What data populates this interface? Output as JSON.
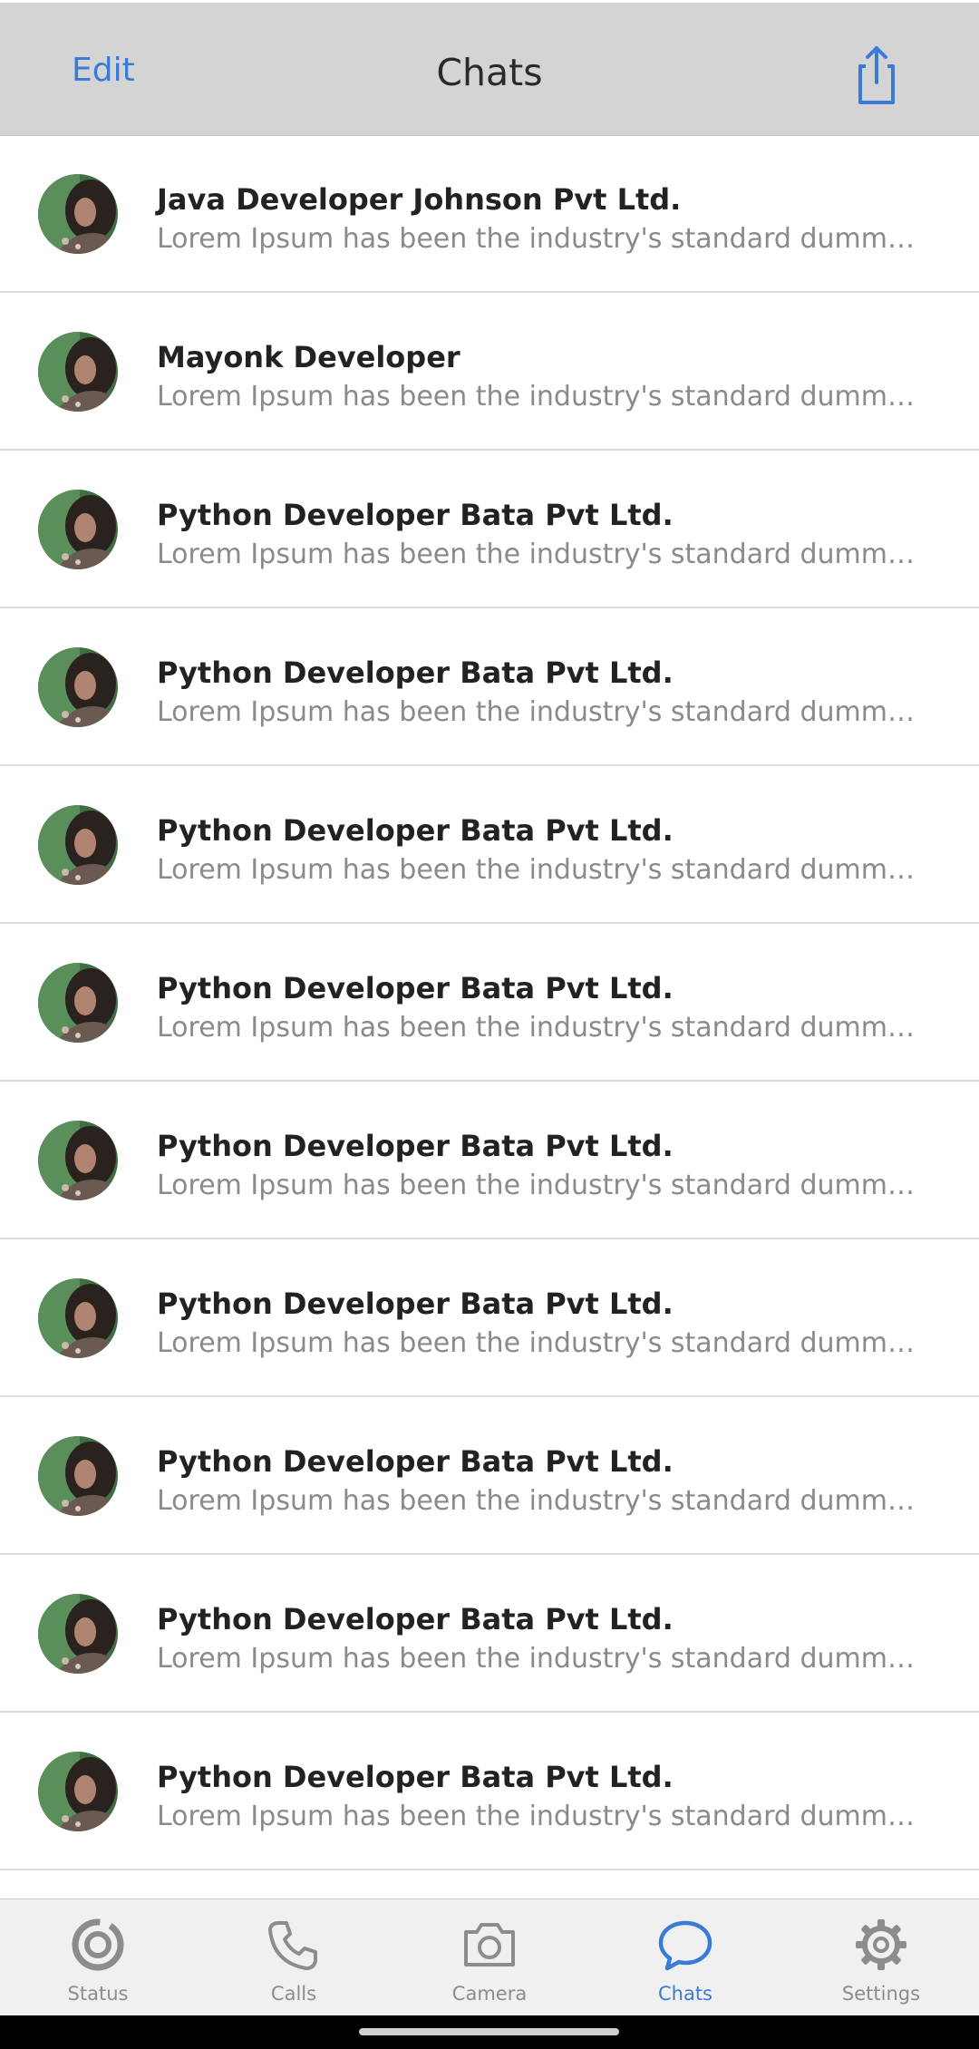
{
  "header": {
    "edit_label": "Edit",
    "title": "Chats",
    "share_icon": "share-icon"
  },
  "chats": [
    {
      "name": "Java Developer Johnson Pvt Ltd.",
      "preview": "Lorem Ipsum has been the industry's standard dummy text ev..."
    },
    {
      "name": "Mayonk Developer",
      "preview": "Lorem Ipsum has been the industry's standard dummy text ev..."
    },
    {
      "name": "Python Developer Bata Pvt Ltd.",
      "preview": "Lorem Ipsum has been the industry's standard dummy text ev..."
    },
    {
      "name": "Python Developer Bata Pvt Ltd.",
      "preview": "Lorem Ipsum has been the industry's standard dummy text ev..."
    },
    {
      "name": "Python Developer Bata Pvt Ltd.",
      "preview": "Lorem Ipsum has been the industry's standard dummy text ev..."
    },
    {
      "name": "Python Developer Bata Pvt Ltd.",
      "preview": "Lorem Ipsum has been the industry's standard dummy text ev..."
    },
    {
      "name": "Python Developer Bata Pvt Ltd.",
      "preview": "Lorem Ipsum has been the industry's standard dummy text ev..."
    },
    {
      "name": "Python Developer Bata Pvt Ltd.",
      "preview": "Lorem Ipsum has been the industry's standard dummy text ev..."
    },
    {
      "name": "Python Developer Bata Pvt Ltd.",
      "preview": "Lorem Ipsum has been the industry's standard dummy text ev..."
    },
    {
      "name": "Python Developer Bata Pvt Ltd.",
      "preview": "Lorem Ipsum has been the industry's standard dummy text ev..."
    },
    {
      "name": "Python Developer Bata Pvt Ltd.",
      "preview": "Lorem Ipsum has been the industry's standard dummy text ev..."
    }
  ],
  "tabbar": {
    "tabs": [
      {
        "label": "Status",
        "icon": "status-icon",
        "active": false
      },
      {
        "label": "Calls",
        "icon": "phone-icon",
        "active": false
      },
      {
        "label": "Camera",
        "icon": "camera-icon",
        "active": false
      },
      {
        "label": "Chats",
        "icon": "chat-bubble-icon",
        "active": true
      },
      {
        "label": "Settings",
        "icon": "gear-icon",
        "active": false
      }
    ]
  },
  "colors": {
    "accent": "#3a7bd5",
    "header_bg": "#d4d4d4",
    "tab_inactive": "#8c8c8c"
  }
}
